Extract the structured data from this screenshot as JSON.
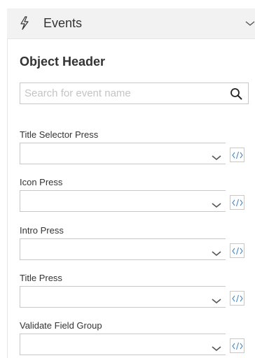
{
  "panel": {
    "title": "Events",
    "icon": "lightning-bolt-icon"
  },
  "section": {
    "title": "Object Header"
  },
  "search": {
    "placeholder": "Search for event name",
    "value": "",
    "icon": "search-icon"
  },
  "events": [
    {
      "label": "Title Selector Press",
      "value": ""
    },
    {
      "label": "Icon Press",
      "value": ""
    },
    {
      "label": "Intro Press",
      "value": ""
    },
    {
      "label": "Title Press",
      "value": ""
    },
    {
      "label": "Validate Field Group",
      "value": ""
    }
  ],
  "colors": {
    "header_bg": "#f2f2f2",
    "border": "#c8c8c8",
    "text": "#333333",
    "placeholder": "#c4c4c4"
  }
}
